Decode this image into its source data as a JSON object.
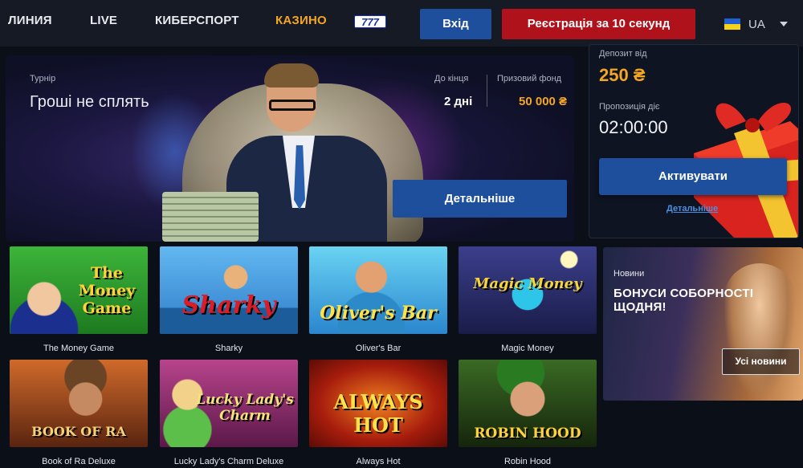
{
  "nav": {
    "items": [
      {
        "label": "ЛИНИЯ"
      },
      {
        "label": "LIVE"
      },
      {
        "label": "КИБЕРСПОРТ"
      },
      {
        "label": "КАЗИНО"
      }
    ],
    "badge_777": "777",
    "active_color": "#f5a623",
    "login_label": "Вхід",
    "register_label": "Реєстрація за 10 секунд",
    "language": "UA"
  },
  "tournament": {
    "type_label": "Турнір",
    "title": "Гроші не сплять",
    "deadline_label": "До кінця",
    "deadline_value": "2 дні",
    "prize_label": "Призовий фонд",
    "prize_value": "50 000 ₴",
    "details_button": "Детальніше"
  },
  "bonus": {
    "deposit_label": "Депозит від",
    "deposit_value": "250 ₴",
    "offer_label": "Пропозиція діє",
    "timer": "02:00:00",
    "activate_button": "Активувати",
    "details_link": "Детальніше"
  },
  "games": [
    {
      "name": "The Money Game",
      "logo": "The Money Game",
      "bg": "#2f9b2f"
    },
    {
      "name": "Sharky",
      "logo": "Sharky",
      "bg": "#4aa3df"
    },
    {
      "name": "Oliver's Bar",
      "logo": "Oliver's Bar",
      "bg": "#2b8fd6"
    },
    {
      "name": "Magic Money",
      "logo": "Magic Money",
      "bg": "#2b2e66"
    },
    {
      "name": "Book of Ra Deluxe",
      "logo": "BOOK OF RA",
      "bg": "#9c4a1d"
    },
    {
      "name": "Lucky Lady's Charm Deluxe",
      "logo": "Lucky Lady's Charm",
      "bg": "#8a2d6a"
    },
    {
      "name": "Always Hot",
      "logo": "ALWAYS HOT",
      "bg": "#b3280f"
    },
    {
      "name": "Robin Hood",
      "logo": "ROBIN HOOD",
      "bg": "#2c4a1e"
    }
  ],
  "news": {
    "label": "Новини",
    "headline": "БОНУСИ СОБОРНОСТІ ЩОДНЯ!",
    "all_news_button": "Усі новини"
  }
}
